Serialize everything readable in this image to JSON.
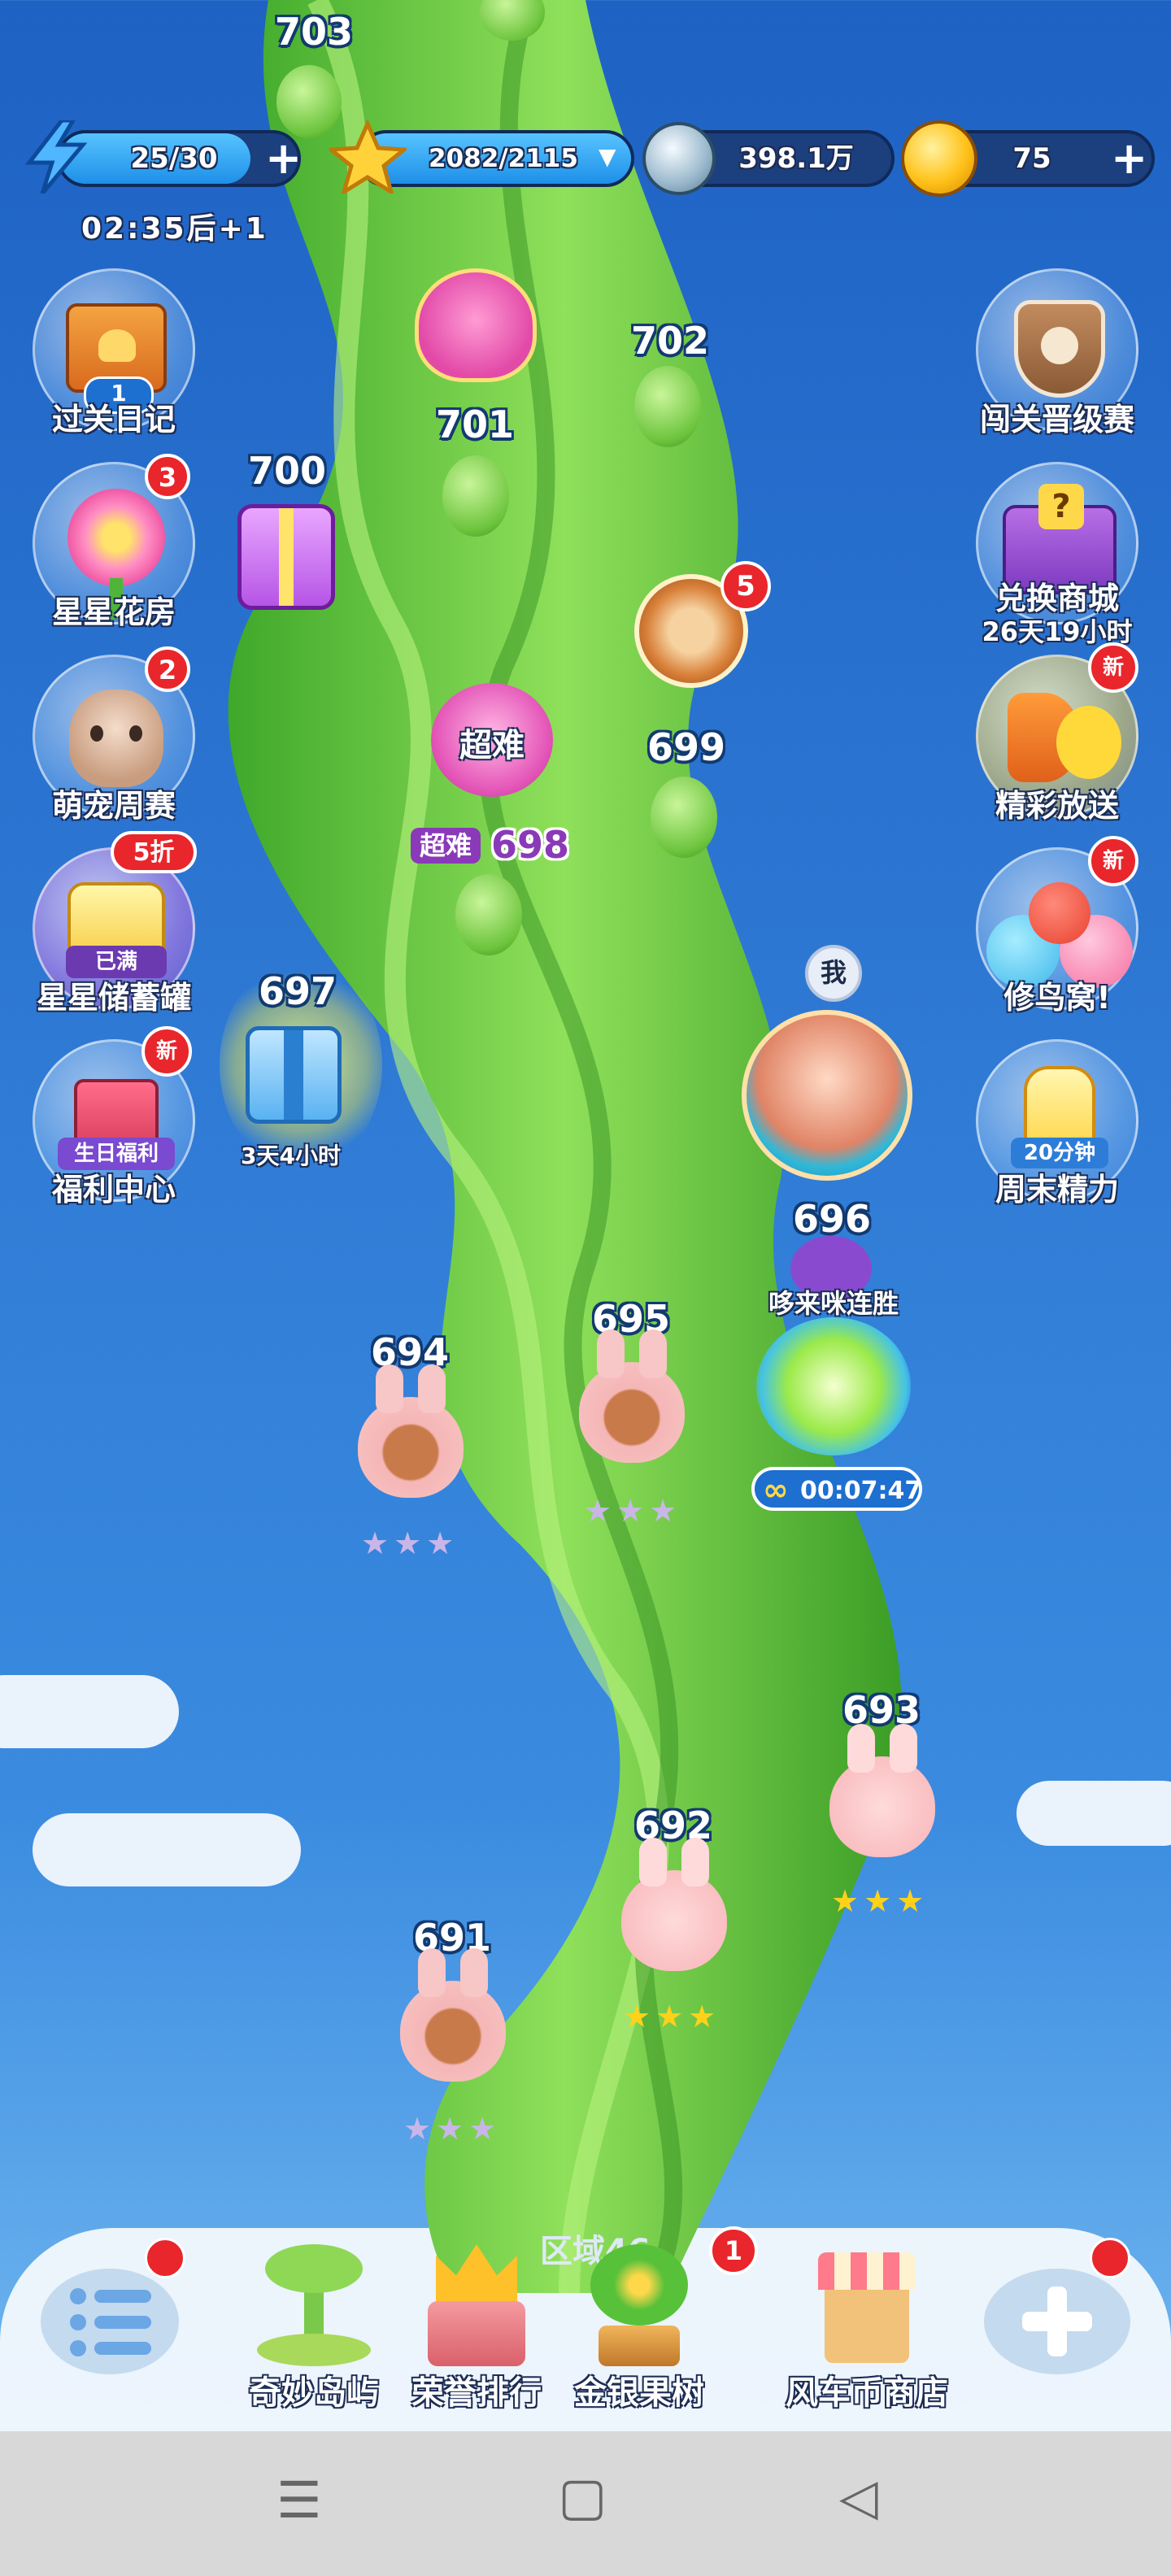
{
  "resources": {
    "energy": {
      "value": "25/30",
      "plus": "+",
      "timer": "02:35后+1"
    },
    "stars": {
      "value": "2082/2115",
      "dropdown": "▼"
    },
    "silver": {
      "value": "398.1万"
    },
    "gold": {
      "value": "75",
      "plus": "+"
    }
  },
  "left_menu": [
    {
      "label": "过关日记",
      "badge": "1"
    },
    {
      "label": "星星花房",
      "badge": "3"
    },
    {
      "label": "萌宠周赛",
      "badge": "2"
    },
    {
      "label": "星星储蓄罐",
      "badge": "5折",
      "tag": "已满"
    },
    {
      "label": "福利中心",
      "badge": "新",
      "tag": "生日福利"
    }
  ],
  "right_menu": [
    {
      "label": "闯关晋级赛"
    },
    {
      "label": "兑换商城",
      "sub": "26天19小时"
    },
    {
      "label": "精彩放送",
      "badge": "新"
    },
    {
      "label": "修鸟窝!",
      "badge": "新"
    },
    {
      "label": "周末精力",
      "tag": "20分钟"
    }
  ],
  "map": {
    "levels": [
      "703",
      "702",
      "701",
      "700",
      "699",
      "698",
      "697",
      "696",
      "695",
      "694",
      "693",
      "692",
      "691"
    ],
    "super_hard": "超难",
    "super_hard_tag": "超难",
    "wheel_badge": "5",
    "gift_timer": "3天4小时",
    "me_marker": "我",
    "streak_label": "哆来咪连胜",
    "streak_timer": "00:07:47",
    "infinity": "∞",
    "zone": "区域46",
    "stars_three": "★★★"
  },
  "bottom_nav": [
    {
      "label": "奇妙岛屿"
    },
    {
      "label": "荣誉排行"
    },
    {
      "label": "金银果树",
      "badge": "1"
    },
    {
      "label": "风车币商店"
    }
  ],
  "system_nav": {
    "menu": "☰",
    "home": "▢",
    "back": "◁"
  },
  "colors": {
    "accent_red": "#e8262c",
    "stalk_green": "#5fc63a",
    "sky_blue": "#2a73d0"
  }
}
